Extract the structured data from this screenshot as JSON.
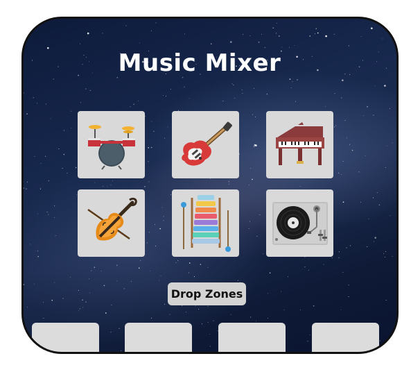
{
  "app": {
    "title": "Music Mixer"
  },
  "instruments": [
    {
      "name": "drums-icon",
      "label": "Drums"
    },
    {
      "name": "electric-guitar-icon",
      "label": "Electric Guitar"
    },
    {
      "name": "piano-icon",
      "label": "Piano"
    },
    {
      "name": "violin-icon",
      "label": "Violin"
    },
    {
      "name": "xylophone-icon",
      "label": "Xylophone"
    },
    {
      "name": "turntable-icon",
      "label": "Turntable"
    }
  ],
  "drop_zones": {
    "label": "Drop Zones",
    "count": 4
  },
  "colors": {
    "tile_bg": "#d9d9d9",
    "zone_bg": "#dcdcdc",
    "frame_border": "#111111",
    "title_text": "#ffffff"
  }
}
